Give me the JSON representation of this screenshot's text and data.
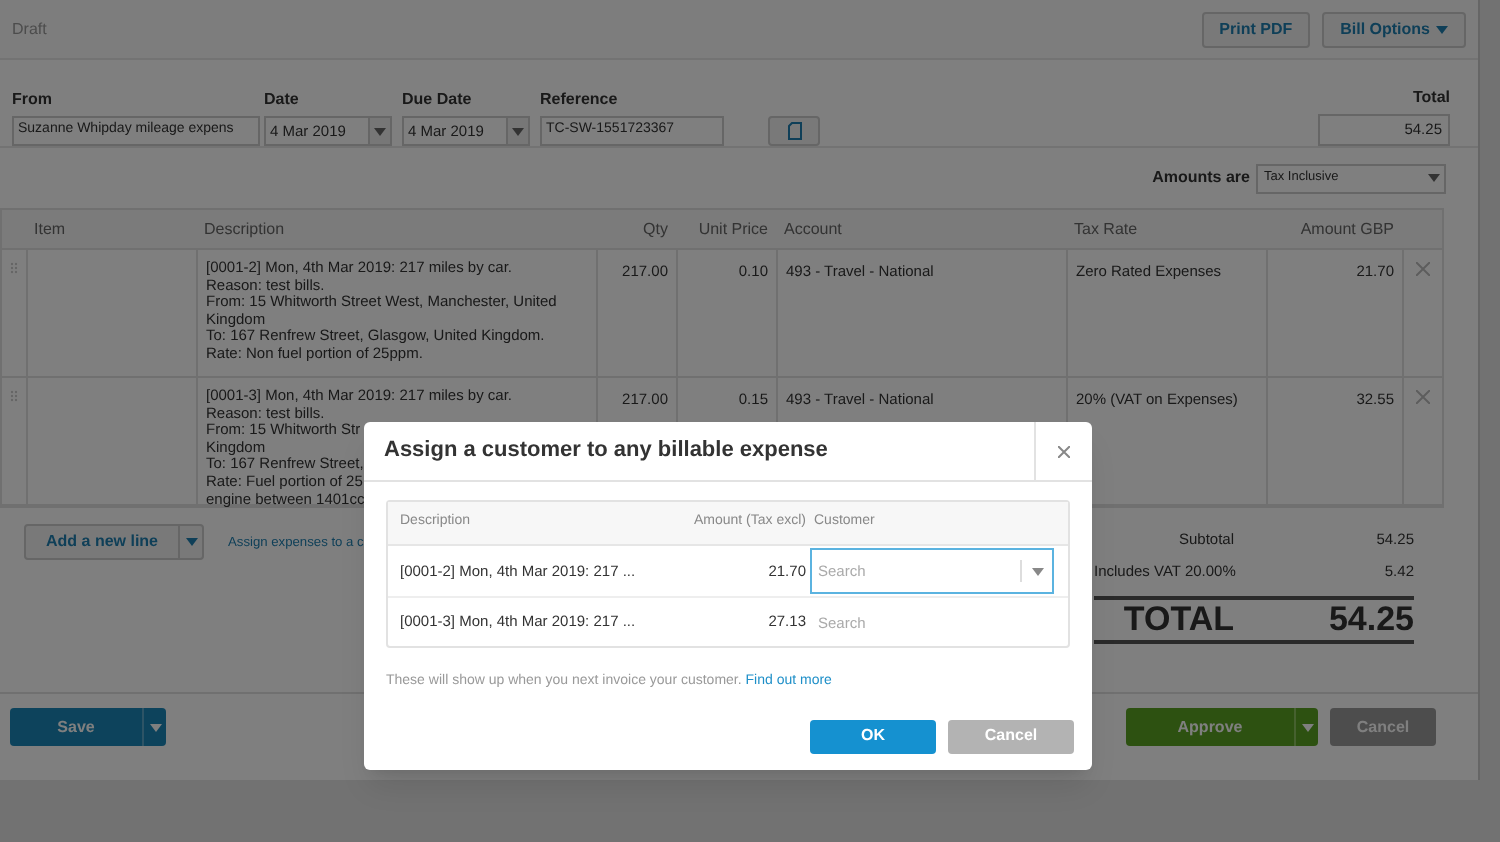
{
  "header": {
    "status": "Draft",
    "buttons": [
      {
        "label": "Print PDF",
        "dropdown": false
      },
      {
        "label": "Bill Options",
        "dropdown": true
      }
    ]
  },
  "fields": [
    {
      "label": "From",
      "value": "Suzanne Whipday mileage expens",
      "kind": "text"
    },
    {
      "label": "Date",
      "value": "4 Mar 2019",
      "kind": "date"
    },
    {
      "label": "Due Date",
      "value": "4 Mar 2019",
      "kind": "date"
    },
    {
      "label": "Reference",
      "value": "TC-SW-1551723367",
      "kind": "text"
    }
  ],
  "total": {
    "label": "Total",
    "value": "54.25"
  },
  "amounts_are": {
    "label": "Amounts are",
    "value": "Tax Inclusive"
  },
  "table": {
    "columns": [
      "Item",
      "Description",
      "Qty",
      "Unit Price",
      "Account",
      "Tax Rate",
      "Amount GBP"
    ],
    "rows": [
      {
        "item": "",
        "description": [
          "[0001-2] Mon, 4th Mar 2019: 217 miles by car.",
          "Reason: test bills.",
          "From: 15 Whitworth Street West, Manchester, United",
          "Kingdom",
          "To: 167 Renfrew Street, Glasgow, United Kingdom.",
          "Rate: Non fuel portion of 25ppm."
        ],
        "qty": "217.00",
        "unit_price": "0.10",
        "account": "493 - Travel - National",
        "tax_rate": "Zero Rated Expenses",
        "amount": "21.70"
      },
      {
        "item": "",
        "description": [
          "[0001-3] Mon, 4th Mar 2019: 217 miles by car.",
          "Reason: test bills.",
          "From: 15 Whitworth Str",
          "Kingdom",
          "To: 167 Renfrew Street,",
          "Rate: Fuel portion of 25",
          "engine between 1401cc"
        ],
        "qty": "217.00",
        "unit_price": "0.15",
        "account": "493 - Travel - National",
        "tax_rate": "20% (VAT on Expenses)",
        "amount": "32.55"
      }
    ]
  },
  "add_line": {
    "label": "Add a new line"
  },
  "assign_link": "Assign expenses to a c",
  "totals": [
    {
      "label": "Subtotal",
      "value": "54.25",
      "kind": "line"
    },
    {
      "label": "Includes VAT 20.00%",
      "value": "5.42",
      "kind": "line"
    },
    {
      "label": "TOTAL",
      "value": "54.25",
      "kind": "grand"
    }
  ],
  "footer": {
    "save": "Save",
    "approve": "Approve",
    "cancel": "Cancel"
  },
  "dialog": {
    "title": "Assign a customer to any billable expense",
    "columns": [
      "Description",
      "Amount (Tax excl)",
      "Customer"
    ],
    "rows": [
      {
        "description": "[0001-2] Mon, 4th Mar 2019: 217 ...",
        "amount": "21.70",
        "customer_placeholder": "Search",
        "focused": true
      },
      {
        "description": "[0001-3] Mon, 4th Mar 2019: 217 ...",
        "amount": "27.13",
        "customer_placeholder": "Search",
        "focused": false
      }
    ],
    "note": "These will show up when you next invoice your customer.",
    "link": "Find out more",
    "buttons": [
      {
        "label": "OK",
        "kind": "primary"
      },
      {
        "label": "Cancel",
        "kind": "secondary"
      }
    ]
  }
}
